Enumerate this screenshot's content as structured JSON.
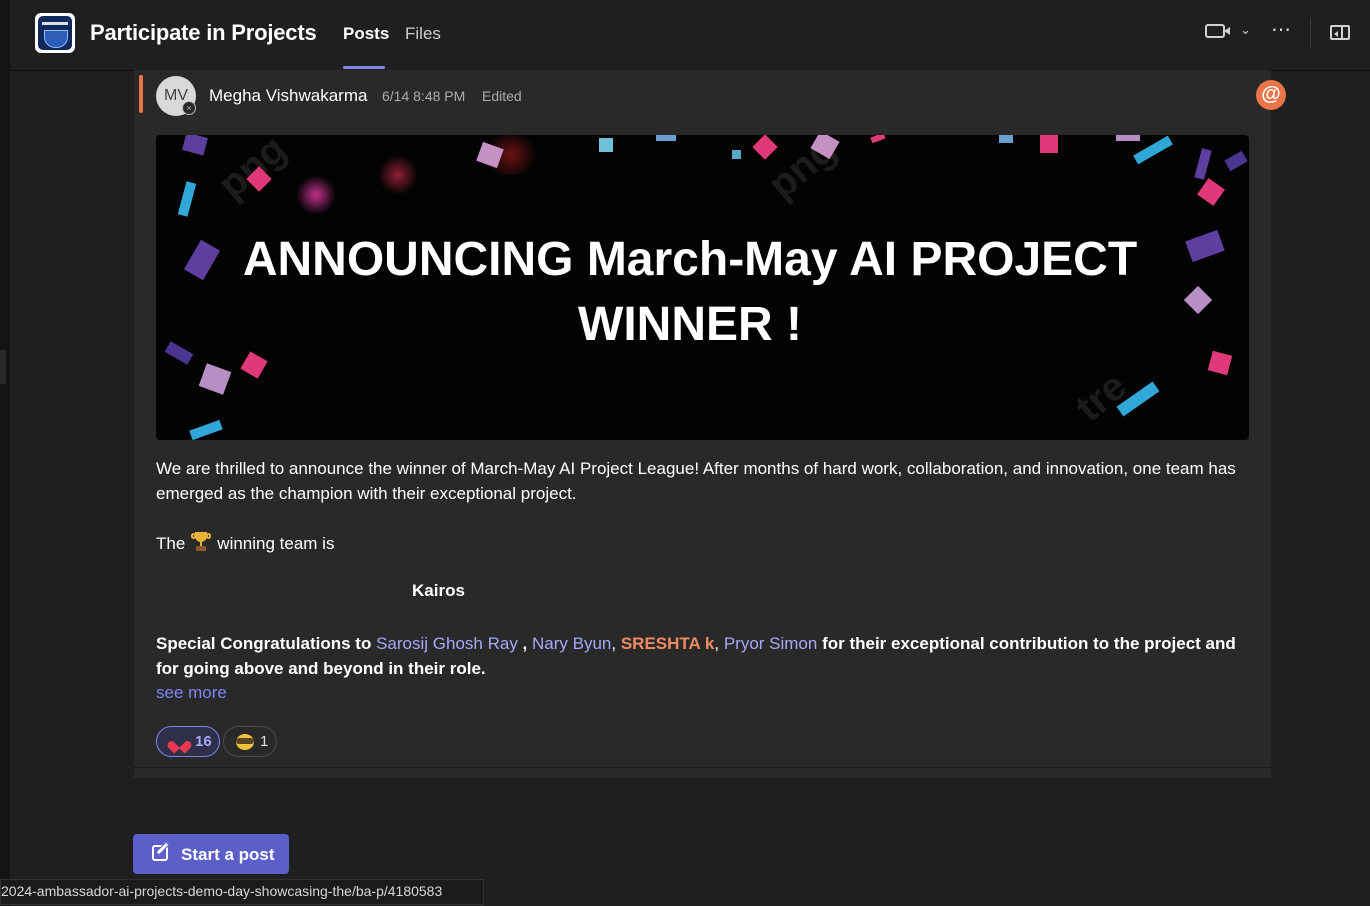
{
  "header": {
    "channel_title": "Participate in Projects",
    "tabs": [
      {
        "label": "Posts",
        "active": true
      },
      {
        "label": "Files",
        "active": false
      }
    ],
    "icons": [
      "video-call-icon",
      "chevron-down-icon",
      "more-options-icon",
      "open-panel-icon"
    ]
  },
  "post": {
    "avatar_initials": "MV",
    "author": "Megha Vishwakarma",
    "timestamp": "6/14 8:48 PM",
    "edited_label": "Edited",
    "mention_badge": "@",
    "banner_title_line1": "ANNOUNCING March-May AI PROJECT",
    "banner_title_line2": "WINNER !",
    "paragraph1": "We are thrilled to announce the winner of March-May AI Project League! After months of hard work, collaboration, and innovation, one team has emerged as the champion with their exceptional project.",
    "winning_prefix": "The",
    "winning_suffix": "winning team is",
    "team_name": "Kairos",
    "congrats_prefix": "Special Congratulations to",
    "mentions": [
      "Sarosij Ghosh Ray",
      "Nary Byun",
      "SRESHTA k",
      "Pryor Simon"
    ],
    "sep_space_comma": " , ",
    "sep_comma": ", ",
    "congrats_suffix": " for their exceptional contribution to the project and for going above and beyond in their role.",
    "see_more": "see more",
    "reactions": [
      {
        "emoji": "heart",
        "count": "16",
        "selected": true
      },
      {
        "emoji": "masked-face",
        "count": "1",
        "selected": false
      }
    ]
  },
  "compose": {
    "start_post_label": "Start a post"
  },
  "status_bar": {
    "url": "2024-ambassador-ai-projects-demo-day-showcasing-the/ba-p/4180583"
  },
  "colors": {
    "accent": "#5b5fc7",
    "mention": "#a5a9f8",
    "author_accent": "#e97548"
  }
}
